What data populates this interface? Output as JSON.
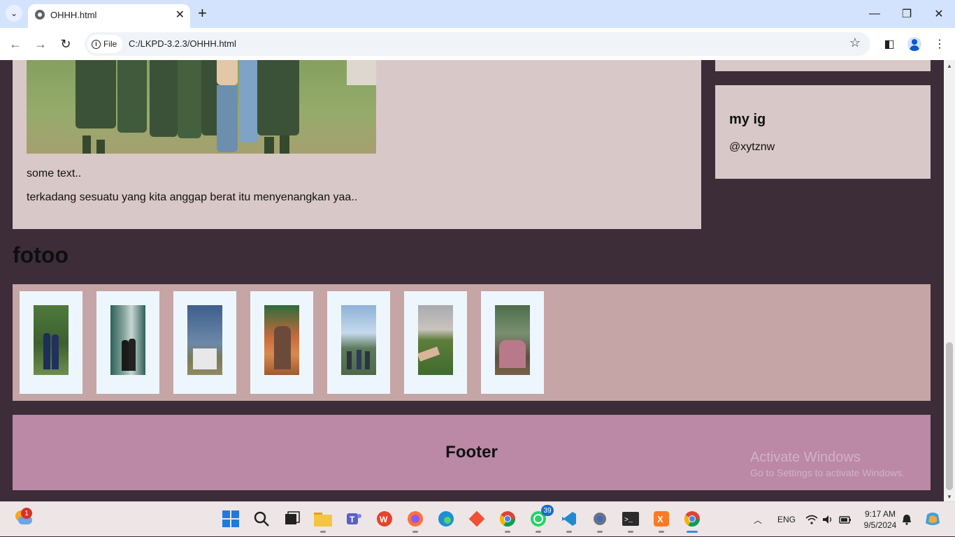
{
  "browser": {
    "tab_title": "OHHH.html",
    "site_chip": "File",
    "url": "C:/LKPD-3.2.3/OHHH.html"
  },
  "page": {
    "main_texts": [
      "some text..",
      "terkadang sesuatu yang kita anggap berat itu menyenangkan yaa.."
    ],
    "side_title": "my ig",
    "side_text": "@xytznw",
    "section_heading": "fotoo",
    "photos": [
      {
        "name": "photo-1"
      },
      {
        "name": "photo-2"
      },
      {
        "name": "photo-3"
      },
      {
        "name": "photo-4"
      },
      {
        "name": "photo-5"
      },
      {
        "name": "photo-6"
      },
      {
        "name": "photo-7"
      }
    ],
    "footer": "Footer",
    "watermark_title": "Activate Windows",
    "watermark_sub": "Go to Settings to activate Windows."
  },
  "taskbar": {
    "weather_badge": "1",
    "whatsapp_badge": "39",
    "language": "ENG",
    "time": "9:17 AM",
    "date": "9/5/2024"
  }
}
